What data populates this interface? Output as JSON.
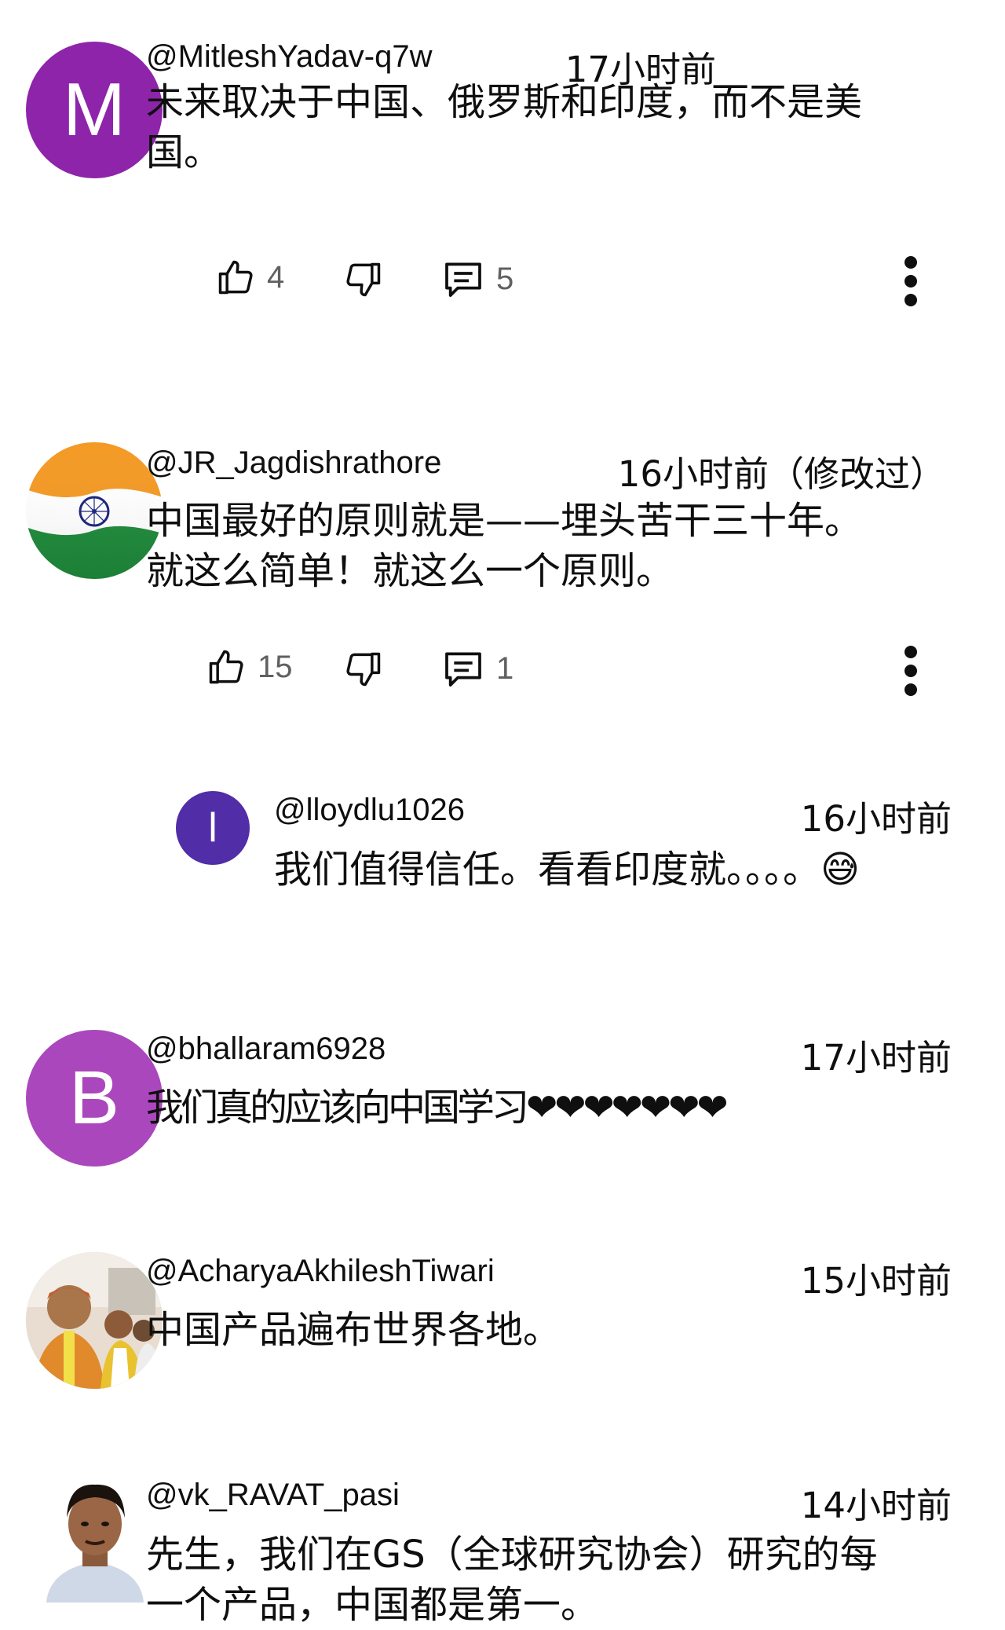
{
  "comments": [
    {
      "handle": "@MitleshYadav-q7w",
      "time": "17小时前",
      "avatar_letter": "M",
      "avatar_color": "#8e24aa",
      "text_lines": [
        "未来取决于中国、俄罗斯和印度，而不是美",
        "国。"
      ],
      "likes": "4",
      "replies": "5"
    },
    {
      "handle": "@JR_Jagdishrathore",
      "time": "16小时前（修改过）",
      "avatar_type": "india-flag",
      "text_lines": [
        "中国最好的原则就是——埋头苦干三十年。",
        "就这么简单！就这么一个原则。"
      ],
      "likes": "15",
      "replies": "1"
    },
    {
      "handle": "@lloydlu1026",
      "time": "16小时前",
      "avatar_letter": "l",
      "avatar_color": "#512da8",
      "text_lines": [
        "我们值得信任。看看印度就。。。。😅"
      ]
    },
    {
      "handle": "@bhallaram6928",
      "time": "17小时前",
      "avatar_letter": "B",
      "avatar_color": "#ab47bc",
      "text_lines": [
        "我们真的应该向中国学习❤❤❤❤❤❤❤"
      ]
    },
    {
      "handle": "@AcharyaAkhileshTiwari",
      "time": "15小时前",
      "avatar_type": "photo",
      "text_lines": [
        "中国产品遍布世界各地。"
      ]
    },
    {
      "handle": "@vk_RAVAT_pasi",
      "time": "14小时前",
      "avatar_type": "photo",
      "text_lines": [
        "先生，我们在GS（全球研究协会）研究的每",
        "一个产品，中国都是第一。"
      ]
    }
  ]
}
